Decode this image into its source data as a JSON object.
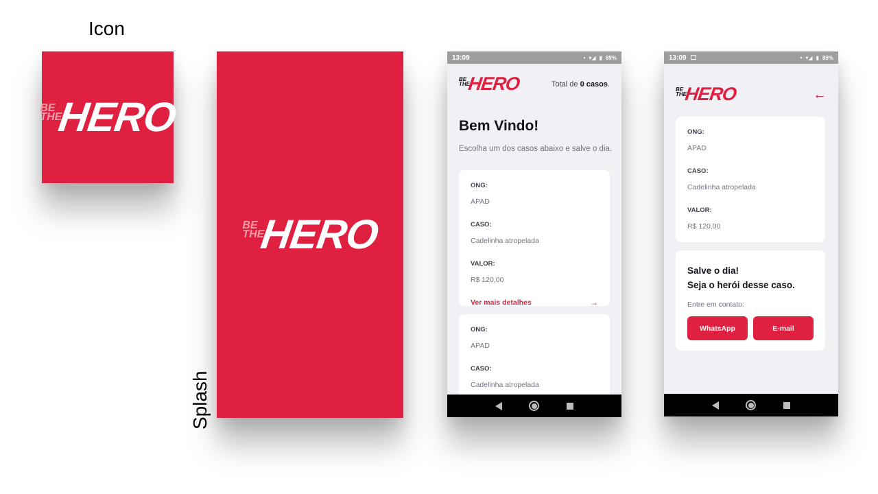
{
  "captions": {
    "icon": "Icon",
    "splash": "Splash"
  },
  "logo": {
    "line1": "BE",
    "line2": "THE",
    "word": "HERO"
  },
  "colors": {
    "brand": "#e02041",
    "background": "#f0f0f5",
    "text_dark": "#13131a",
    "text_muted": "#737380"
  },
  "status_bar": {
    "time": "13:09",
    "battery": "89%"
  },
  "list_screen": {
    "total_prefix": "Total de",
    "total_count": "0 casos",
    "total_suffix": ".",
    "welcome": "Bem Vindo!",
    "subtitle": "Escolha um dos casos abaixo e salve o dia.",
    "cards": [
      {
        "ong_label": "ONG:",
        "ong": "APAD",
        "case_label": "CASO:",
        "case": "Cadelinha atropelada",
        "value_label": "VALOR:",
        "value": "R$ 120,00",
        "details_label": "Ver mais detalhes"
      },
      {
        "ong_label": "ONG:",
        "ong": "APAD",
        "case_label": "CASO:",
        "case": "Cadelinha atropelada"
      }
    ]
  },
  "detail_screen": {
    "ong_label": "ONG:",
    "ong": "APAD",
    "case_label": "CASO:",
    "case": "Cadelinha atropelada",
    "value_label": "VALOR:",
    "value": "R$ 120,00",
    "hero_line1": "Salve o dia!",
    "hero_line2": "Seja o herói desse caso.",
    "contact_label": "Entre em contato:",
    "whatsapp_label": "WhatsApp",
    "email_label": "E-mail"
  },
  "icons": {
    "back": "arrow-left-icon",
    "details": "arrow-right-icon"
  }
}
